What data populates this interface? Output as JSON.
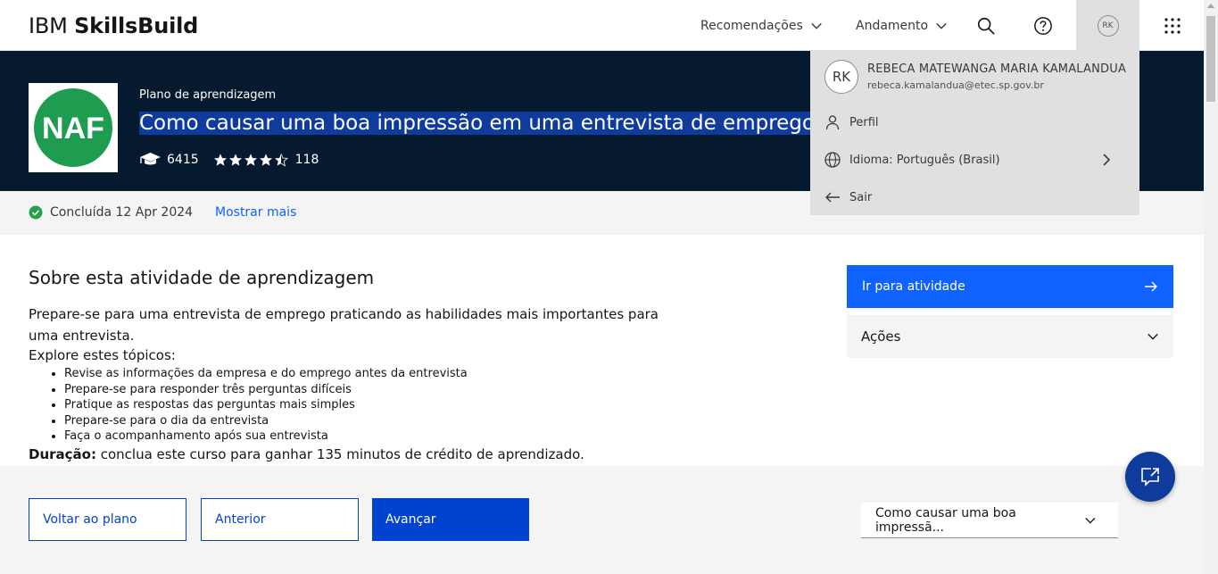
{
  "header": {
    "brand_light": "IBM",
    "brand_bold": "SkillsBuild",
    "nav": [
      {
        "label": "Recomendações"
      },
      {
        "label": "Andamento"
      }
    ],
    "avatar_initials": "RK"
  },
  "hero": {
    "logo_text": "NAF",
    "kicker": "Plano de aprendizagem",
    "title": "Como causar uma boa impressão em uma entrevista de emprego (Job",
    "learners": "6415",
    "rating_count": "118",
    "rating_value": 4.5
  },
  "status": {
    "completed": "Concluída 12 Apr 2024",
    "show_more": "Mostrar mais"
  },
  "about": {
    "title": "Sobre esta atividade de aprendizagem",
    "description": "Prepare-se para uma entrevista de emprego praticando as habilidades mais importantes para uma entrevista.",
    "explore": "Explore estes tópicos:",
    "topics": [
      "Revise as informações da empresa e do emprego antes da entrevista",
      "Prepare-se para responder três perguntas difíceis",
      "Pratique as respostas das perguntas mais simples",
      "Prepare-se para o dia da entrevista",
      "Faça o acompanhamento após sua entrevista"
    ],
    "duration_label": "Duração:",
    "duration_text": " conclua este curso para ganhar 135 minutos de crédito de aprendizado."
  },
  "side": {
    "cta": "Ir para atividade",
    "actions": "Ações"
  },
  "footer": {
    "back": "Voltar ao plano",
    "prev": "Anterior",
    "next": "Avançar",
    "select_value": "Como causar uma boa impressã..."
  },
  "dropdown": {
    "initials": "RK",
    "name": "REBECA MATEWANGA MARIA KAMALANDUA",
    "email": "rebeca.kamalandua@etec.sp.gov.br",
    "profile": "Perfil",
    "language": "Idioma: Português (Brasil)",
    "logout": "Sair"
  },
  "colors": {
    "accent": "#0f62fe",
    "hero_bg": "#051a2e",
    "footer_primary": "#0043ce",
    "success": "#24a148",
    "logo_green": "#1e9c4f"
  }
}
